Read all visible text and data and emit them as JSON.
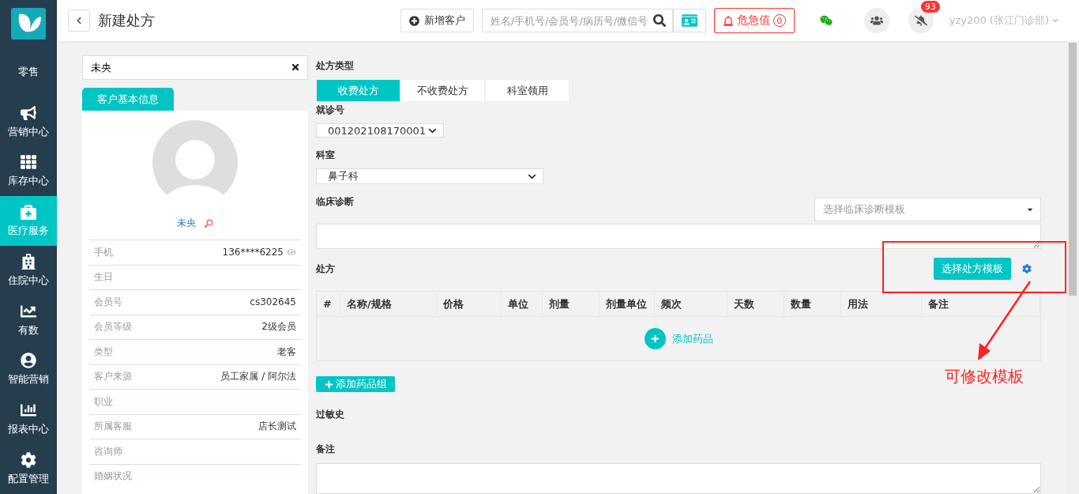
{
  "sidebar": {
    "items": [
      {
        "label": "零售",
        "selected": false
      },
      {
        "label": "营销中心",
        "selected": false
      },
      {
        "label": "库存中心",
        "selected": false
      },
      {
        "label": "医疗服务",
        "selected": true
      },
      {
        "label": "住院中心",
        "selected": false
      },
      {
        "label": "有数",
        "selected": false
      },
      {
        "label": "智能营销",
        "selected": false
      },
      {
        "label": "报表中心",
        "selected": false
      },
      {
        "label": "配置管理",
        "selected": false
      }
    ]
  },
  "header": {
    "title": "新建处方",
    "new_customer": "新增客户",
    "search": {
      "placeholder": "姓名/手机号/会员号/病历号/微信号"
    },
    "alert": {
      "label": "危急值",
      "count": "0"
    },
    "notification_count": "93",
    "user": "yzy200 (张江门诊部)"
  },
  "customer": {
    "search_value": "未央",
    "tab": "客户基本信息",
    "name": "未央",
    "rows": [
      {
        "label": "手机",
        "value": "136****6225",
        "kind": "masked"
      },
      {
        "label": "生日",
        "kind": "plain"
      },
      {
        "label": "会员号",
        "value": "cs302645",
        "kind": "plain"
      },
      {
        "label": "会员等级",
        "value": "2级会员",
        "kind": "plain"
      },
      {
        "label": "类型",
        "value": "老客",
        "kind": "plain"
      },
      {
        "label": "客户来源",
        "value": "员工家属 / 阿尔法",
        "kind": "plain"
      },
      {
        "label": "职业",
        "kind": "plain"
      },
      {
        "label": "所属客服",
        "value": "店长测试",
        "kind": "plain"
      },
      {
        "label": "咨询师",
        "kind": "plain"
      },
      {
        "label": "婚姻状况",
        "kind": "plain"
      }
    ]
  },
  "form": {
    "type_label": "处方类型",
    "type_tabs": [
      {
        "label": "收费处方",
        "selected": true
      },
      {
        "label": "不收费处方",
        "selected": false
      },
      {
        "label": "科室领用",
        "selected": false
      }
    ],
    "visit_no": {
      "label": "就诊号",
      "value": "001202108170001"
    },
    "department": {
      "label": "科室",
      "value": "鼻子科"
    },
    "diagnosis": {
      "label": "临床诊断",
      "template_placeholder": "选择临床诊断模板"
    },
    "prescription": {
      "label": "处方",
      "template_button": "选择处方模板",
      "columns": [
        "#",
        "名称/规格",
        "价格",
        "单位",
        "剂量",
        "剂量单位",
        "频次",
        "天数",
        "数量",
        "用法",
        "备注"
      ],
      "add_drug": "添加药品",
      "add_group": "添加药品组"
    },
    "allergy_label": "过敏史",
    "remark_label": "备注"
  },
  "annotation": {
    "text": "可修改模板"
  }
}
